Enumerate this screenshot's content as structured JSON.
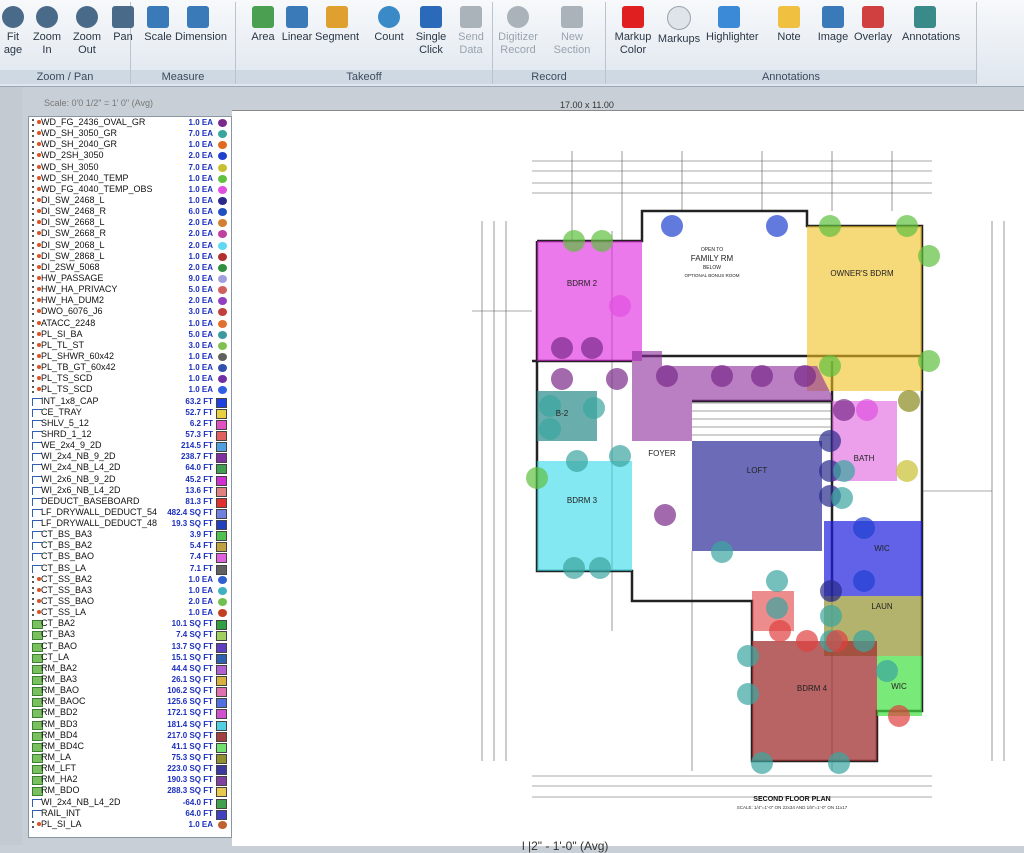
{
  "ribbon": {
    "groups": [
      {
        "name": "Zoom / Pan",
        "tools": [
          {
            "l1": "Fit",
            "l2": "age",
            "icon": "zoom-fit-icon"
          },
          {
            "l1": "Zoom",
            "l2": "In",
            "icon": "zoom-in-icon"
          },
          {
            "l1": "Zoom",
            "l2": "Out",
            "icon": "zoom-out-icon"
          },
          {
            "l1": "Pan",
            "l2": "",
            "icon": "pan-hand-icon"
          }
        ]
      },
      {
        "name": "Measure",
        "tools": [
          {
            "l1": "Scale",
            "l2": "",
            "icon": "scale-icon"
          },
          {
            "l1": "Dimension",
            "l2": "",
            "icon": "dimension-icon"
          }
        ]
      },
      {
        "name": "Takeoff",
        "tools": [
          {
            "l1": "Area",
            "l2": "",
            "icon": "area-icon"
          },
          {
            "l1": "Linear",
            "l2": "",
            "icon": "linear-icon"
          },
          {
            "l1": "Segment",
            "l2": "",
            "icon": "segment-icon"
          },
          {
            "l1": "Count",
            "l2": "",
            "icon": "count-icon"
          },
          {
            "l1": "Single",
            "l2": "Click",
            "icon": "single-click-icon"
          },
          {
            "l1": "Send",
            "l2": "Data",
            "icon": "send-data-icon"
          }
        ]
      },
      {
        "name": "Record",
        "tools": [
          {
            "l1": "Digitizer",
            "l2": "Record",
            "icon": "digitizer-icon"
          },
          {
            "l1": "New",
            "l2": "Section",
            "icon": "new-section-icon"
          }
        ]
      },
      {
        "name": "Annotations",
        "tools": [
          {
            "l1": "Markup",
            "l2": "Color",
            "icon": "markup-color-icon"
          },
          {
            "l1": "Markups",
            "l2": "",
            "icon": "markups-cloud-icon"
          },
          {
            "l1": "Highlighter",
            "l2": "",
            "icon": "highlighter-icon"
          },
          {
            "l1": "Note",
            "l2": "",
            "icon": "note-icon"
          },
          {
            "l1": "Image",
            "l2": "",
            "icon": "image-icon"
          },
          {
            "l1": "Overlay",
            "l2": "",
            "icon": "overlay-icon"
          },
          {
            "l1": "Annotations",
            "l2": "",
            "icon": "annotations-icon"
          }
        ]
      }
    ]
  },
  "scale_text": "Scale: 0'0 1/2\" = 1' 0\" (Avg)",
  "page_size": "17.00 x 11.00",
  "plan": {
    "title": "SECOND FLOOR PLAN",
    "scale_note": "SCALE: 1/4\"=1'-0\" ON 22x34 AND 1/8\"=1'-0\" ON 11x17",
    "rooms": [
      "BDRM 2",
      "FAMILY RM",
      "OWNER'S BDRM",
      "B-2",
      "FOYER",
      "LOFT",
      "BATH",
      "BDRM 3",
      "WIC",
      "LAUN",
      "BDRM 4",
      "WIC"
    ],
    "open_to": "OPEN TO",
    "below": "BELOW",
    "bonus": "OPTIONAL BONUS ROOM"
  },
  "bottom_label": "l        |2\" - 1'-0\" (Avg)",
  "takeoff_items": [
    {
      "name": "WD_FG_2436_OVAL_GR",
      "qty": "1.0 EA",
      "color": "#7a2a8a",
      "kind": "count"
    },
    {
      "name": "WD_SH_3050_GR",
      "qty": "7.0 EA",
      "color": "#3aa5a0",
      "kind": "count"
    },
    {
      "name": "WD_SH_2040_GR",
      "qty": "1.0 EA",
      "color": "#e06a20",
      "kind": "count"
    },
    {
      "name": "WD_2SH_3050",
      "qty": "2.0 EA",
      "color": "#2040d0",
      "kind": "count"
    },
    {
      "name": "WD_SH_3050",
      "qty": "7.0 EA",
      "color": "#c8c030",
      "kind": "count"
    },
    {
      "name": "WD_SH_2040_TEMP",
      "qty": "1.0 EA",
      "color": "#60c040",
      "kind": "count"
    },
    {
      "name": "WD_FG_4040_TEMP_OBS",
      "qty": "1.0 EA",
      "color": "#e050e0",
      "kind": "count"
    },
    {
      "name": "DI_SW_2468_L",
      "qty": "1.0 EA",
      "color": "#2a2a8a",
      "kind": "count"
    },
    {
      "name": "DI_SW_2468_R",
      "qty": "6.0 EA",
      "color": "#2050c0",
      "kind": "count"
    },
    {
      "name": "DI_SW_2668_L",
      "qty": "2.0 EA",
      "color": "#d08030",
      "kind": "count"
    },
    {
      "name": "DI_SW_2668_R",
      "qty": "2.0 EA",
      "color": "#c040a0",
      "kind": "count"
    },
    {
      "name": "DI_SW_2068_L",
      "qty": "2.0 EA",
      "color": "#60d8f0",
      "kind": "count"
    },
    {
      "name": "DI_SW_2868_L",
      "qty": "1.0 EA",
      "color": "#b03030",
      "kind": "count"
    },
    {
      "name": "DI_2SW_5068",
      "qty": "2.0 EA",
      "color": "#309040",
      "kind": "count"
    },
    {
      "name": "HW_PASSAGE",
      "qty": "9.0 EA",
      "color": "#a0a0e0",
      "kind": "count"
    },
    {
      "name": "HW_HA_PRIVACY",
      "qty": "5.0 EA",
      "color": "#d06060",
      "kind": "count"
    },
    {
      "name": "HW_HA_DUM2",
      "qty": "2.0 EA",
      "color": "#9040c0",
      "kind": "count"
    },
    {
      "name": "DWO_6076_J6",
      "qty": "3.0 EA",
      "color": "#c04040",
      "kind": "count"
    },
    {
      "name": "ATACC_2248",
      "qty": "1.0 EA",
      "color": "#e07030",
      "kind": "count"
    },
    {
      "name": "PL_SI_BA",
      "qty": "5.0 EA",
      "color": "#3a9aa0",
      "kind": "count"
    },
    {
      "name": "PL_TL_ST",
      "qty": "3.0 EA",
      "color": "#80c050",
      "kind": "count"
    },
    {
      "name": "PL_SHWR_60x42",
      "qty": "1.0 EA",
      "color": "#606060",
      "kind": "count"
    },
    {
      "name": "PL_TB_GT_60x42",
      "qty": "1.0 EA",
      "color": "#3050b0",
      "kind": "count"
    },
    {
      "name": "PL_TS_SCD",
      "qty": "1.0 EA",
      "color": "#7030a0",
      "kind": "count"
    },
    {
      "name": "PL_TS_SCD",
      "qty": "1.0 EA",
      "color": "#3060e0",
      "kind": "count"
    },
    {
      "name": "INT_1x8_CAP",
      "qty": "63.2 FT",
      "color": "#2040e0",
      "kind": "linear"
    },
    {
      "name": "CE_TRAY",
      "qty": "52.7 FT",
      "color": "#e8d040",
      "kind": "linear"
    },
    {
      "name": "SHLV_5_12",
      "qty": "6.2 FT",
      "color": "#e050c0",
      "kind": "linear"
    },
    {
      "name": "SHRD_1_12",
      "qty": "57.3 FT",
      "color": "#e06060",
      "kind": "linear"
    },
    {
      "name": "WE_2x4_9_2D",
      "qty": "214.5 FT",
      "color": "#50a0e0",
      "kind": "linear"
    },
    {
      "name": "WI_2x4_NB_9_2D",
      "qty": "238.7 FT",
      "color": "#8030a0",
      "kind": "linear"
    },
    {
      "name": "WI_2x4_NB_L4_2D",
      "qty": "64.0 FT",
      "color": "#40a050",
      "kind": "linear"
    },
    {
      "name": "WI_2x6_NB_9_2D",
      "qty": "45.2 FT",
      "color": "#d030d0",
      "kind": "linear"
    },
    {
      "name": "WI_2x6_NB_L4_2D",
      "qty": "13.6 FT",
      "color": "#e08080",
      "kind": "linear"
    },
    {
      "name": "DEDUCT_BASEBOARD",
      "qty": "81.3 FT",
      "color": "#e03030",
      "kind": "linear"
    },
    {
      "name": "LF_DRYWALL_DEDUCT_54",
      "qty": "482.4 SQ FT",
      "color": "#7080e0",
      "kind": "linear"
    },
    {
      "name": "LF_DRYWALL_DEDUCT_48",
      "qty": "19.3 SQ FT",
      "color": "#2040c0",
      "kind": "linear"
    },
    {
      "name": "CT_BS_BA3",
      "qty": "3.9 FT",
      "color": "#50c050",
      "kind": "linear"
    },
    {
      "name": "CT_BS_BA2",
      "qty": "5.4 FT",
      "color": "#c0a040",
      "kind": "linear"
    },
    {
      "name": "CT_BS_BAO",
      "qty": "7.4 FT",
      "color": "#e060e0",
      "kind": "linear"
    },
    {
      "name": "CT_BS_LA",
      "qty": "7.1 FT",
      "color": "#606060",
      "kind": "linear"
    },
    {
      "name": "CT_SS_BA2",
      "qty": "1.0 EA",
      "color": "#3060d0",
      "kind": "count"
    },
    {
      "name": "CT_SS_BA3",
      "qty": "1.0 EA",
      "color": "#40b0c0",
      "kind": "count"
    },
    {
      "name": "CT_SS_BAO",
      "qty": "2.0 EA",
      "color": "#70c050",
      "kind": "count"
    },
    {
      "name": "CT_SS_LA",
      "qty": "1.0 EA",
      "color": "#c04020",
      "kind": "count"
    },
    {
      "name": "CT_BA2",
      "qty": "10.1 SQ FT",
      "color": "#30a040",
      "kind": "area"
    },
    {
      "name": "CT_BA3",
      "qty": "7.4 SQ FT",
      "color": "#a0d060",
      "kind": "area"
    },
    {
      "name": "CT_BAO",
      "qty": "13.7 SQ FT",
      "color": "#6040c0",
      "kind": "area"
    },
    {
      "name": "CT_LA",
      "qty": "15.1 SQ FT",
      "color": "#3060b0",
      "kind": "area"
    },
    {
      "name": "RM_BA2",
      "qty": "44.4 SQ FT",
      "color": "#b060d0",
      "kind": "area"
    },
    {
      "name": "RM_BA3",
      "qty": "26.1 SQ FT",
      "color": "#d8b040",
      "kind": "area"
    },
    {
      "name": "RM_BAO",
      "qty": "106.2 SQ FT",
      "color": "#e070b0",
      "kind": "area"
    },
    {
      "name": "RM_BAOC",
      "qty": "125.6 SQ FT",
      "color": "#5070e0",
      "kind": "area"
    },
    {
      "name": "RM_BD2",
      "qty": "172.1 SQ FT",
      "color": "#d050d0",
      "kind": "area"
    },
    {
      "name": "RM_BD3",
      "qty": "181.4 SQ FT",
      "color": "#50d0e0",
      "kind": "area"
    },
    {
      "name": "RM_BD4",
      "qty": "217.0 SQ FT",
      "color": "#a04040",
      "kind": "area"
    },
    {
      "name": "RM_BD4C",
      "qty": "41.1 SQ FT",
      "color": "#70e070",
      "kind": "area"
    },
    {
      "name": "RM_LA",
      "qty": "75.3 SQ FT",
      "color": "#909030",
      "kind": "area"
    },
    {
      "name": "RM_LFT",
      "qty": "223.0 SQ FT",
      "color": "#3a3aa0",
      "kind": "area"
    },
    {
      "name": "RM_HA2",
      "qty": "190.3 SQ FT",
      "color": "#8040a0",
      "kind": "area"
    },
    {
      "name": "RM_BDO",
      "qty": "288.3 SQ FT",
      "color": "#e8c850",
      "kind": "area"
    },
    {
      "name": "WI_2x4_NB_L4_2D",
      "qty": "-64.0 FT",
      "color": "#40a050",
      "kind": "linear"
    },
    {
      "name": "RAIL_INT",
      "qty": "64.0 FT",
      "color": "#4040c0",
      "kind": "linear"
    },
    {
      "name": "PL_SI_LA",
      "qty": "1.0 EA",
      "color": "#c06030",
      "kind": "count"
    }
  ],
  "colors": {
    "ribbon_group_label": "#cfd9e4",
    "panel_border": "#8a96a3",
    "qty_text": "#1b2fbf"
  }
}
